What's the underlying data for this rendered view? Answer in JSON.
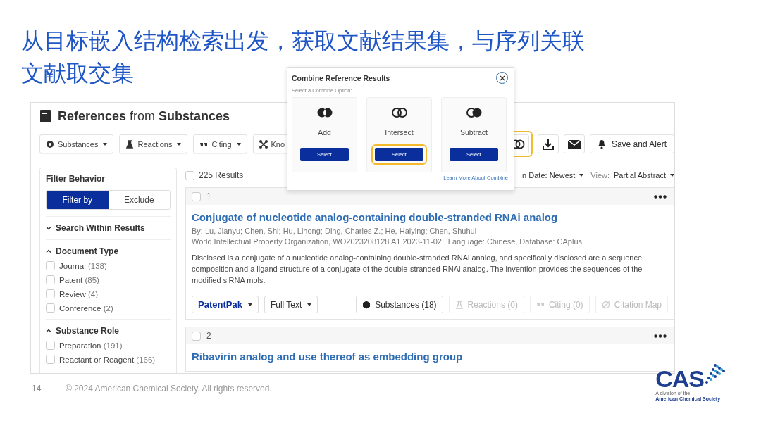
{
  "slide": {
    "title_lines": [
      "从目标嵌入结构检索出发，获取文献结果集，与序列关联",
      "文献取交集"
    ],
    "page_number": "14",
    "copyright": "© 2024 American Chemical Society. All rights reserved.",
    "logo": {
      "text": "CAS",
      "tagline_1": "A division of the",
      "tagline_2": "American Chemical Society"
    }
  },
  "screen": {
    "heading": "**References** from **Substances**",
    "toolbar": [
      {
        "label": "Substances",
        "kind": "dropdown"
      },
      {
        "label": "Reactions",
        "kind": "dropdown"
      },
      {
        "label": "Citing",
        "kind": "dropdown"
      },
      {
        "label": "Kno",
        "kind": "plain"
      }
    ],
    "actions": [
      {
        "kind": "combine",
        "highlighted": true
      },
      {
        "kind": "download",
        "highlighted": false
      },
      {
        "kind": "email",
        "highlighted": false
      },
      {
        "kind": "alert",
        "label": "Save and Alert",
        "highlighted": false
      }
    ],
    "sidebar": {
      "heading": "Filter Behavior",
      "segments": [
        {
          "label": "Filter by",
          "selected": true
        },
        {
          "label": "Exclude",
          "selected": false
        }
      ],
      "sections": [
        {
          "title": "Search Within Results",
          "expanded": false
        },
        {
          "title": "Document Type",
          "expanded": true,
          "options": [
            {
              "label": "Journal",
              "count": "(138)",
              "checked": false
            },
            {
              "label": "Patent",
              "count": "(85)",
              "checked": false
            },
            {
              "label": "Review",
              "count": "(4)",
              "checked": false
            },
            {
              "label": "Conference",
              "count": "(2)",
              "checked": false
            }
          ]
        },
        {
          "title": "Substance Role",
          "expanded": true,
          "options": [
            {
              "label": "Preparation",
              "count": "(191)",
              "checked": false
            },
            {
              "label": "Reactant or Reagent",
              "count": "(166)",
              "checked": false
            }
          ]
        }
      ]
    },
    "results": {
      "count": "225 Results",
      "all_checked": false,
      "sort": "n Date: Newest",
      "view_label": "View:",
      "view": "Partial Abstract"
    },
    "records": [
      {
        "number": "1",
        "checked": false,
        "title": "Conjugate of nucleotide analog-containing double-stranded RNAi analog",
        "authors": "By: Lu, Jianyu; Chen, Shi; Hu, Lihong; Ding, Charles Z.; He, Haiying; Chen, Shuhui",
        "source": "World Intellectual Property Organization, WO2023208128 A1 2023-11-02 | Language: Chinese, Database: CAplus",
        "abstract": "Disclosed is a conjugate of a nucleotide analog-containing double-stranded RNAi analog, and specifically disclosed are a sequence composition and a ligand structure of a conjugate of the double-stranded RNAi analog. The invention provides the sequences of the modified siRNA mols.",
        "buttons": [
          {
            "label": "PatentPak",
            "kind": "patentpak",
            "disabled": false
          },
          {
            "label": "Full Text",
            "kind": "dropdown",
            "disabled": false
          },
          {
            "label": "Substances (18)",
            "kind": "substances",
            "disabled": false
          },
          {
            "label": "Reactions (0)",
            "kind": "reactions",
            "disabled": true
          },
          {
            "label": "Citing (0)",
            "kind": "citing",
            "disabled": true
          },
          {
            "label": "Citation Map",
            "kind": "map",
            "disabled": true
          }
        ]
      },
      {
        "number": "2",
        "checked": false,
        "title": "Ribavirin analog and use thereof as embedding group"
      }
    ],
    "popup": {
      "title": "Combine Reference Results",
      "prompt": "Select a Combine Option:",
      "options": [
        {
          "kind": "add",
          "label": "Add",
          "button": "Select",
          "highlighted": false
        },
        {
          "kind": "intersect",
          "label": "Intersect",
          "button": "Select",
          "highlighted": true
        },
        {
          "kind": "subtract",
          "label": "Subtract",
          "button": "Select",
          "highlighted": false
        }
      ],
      "link": "Learn More About Combine"
    }
  }
}
